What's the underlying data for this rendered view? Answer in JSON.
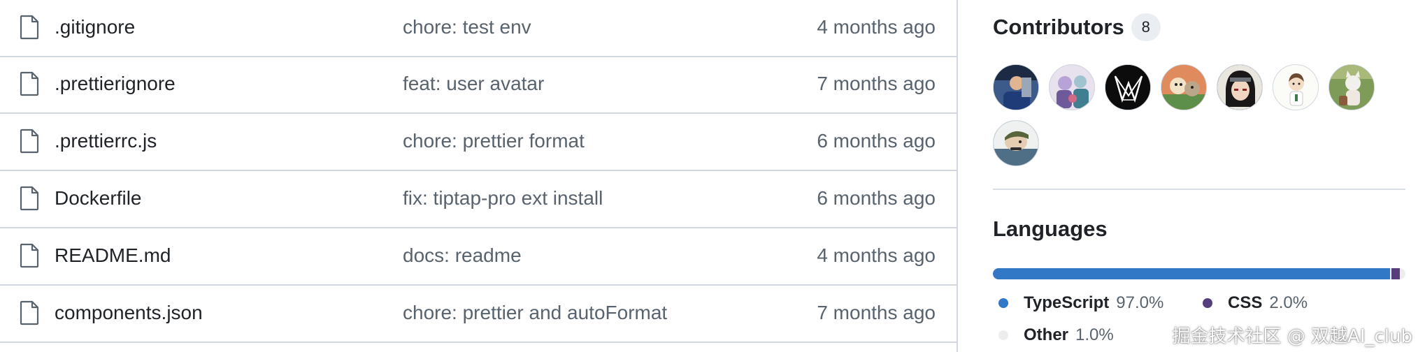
{
  "files": [
    {
      "name": ".gitignore",
      "message": "chore: test env",
      "time": "4 months ago"
    },
    {
      "name": ".prettierignore",
      "message": "feat: user avatar",
      "time": "7 months ago"
    },
    {
      "name": ".prettierrc.js",
      "message": "chore: prettier format",
      "time": "6 months ago"
    },
    {
      "name": "Dockerfile",
      "message": "fix: tiptap-pro ext install",
      "time": "6 months ago"
    },
    {
      "name": "README.md",
      "message": "docs: readme",
      "time": "4 months ago"
    },
    {
      "name": "components.json",
      "message": "chore: prettier and autoFormat",
      "time": "7 months ago"
    }
  ],
  "sidebar": {
    "contributors": {
      "title": "Contributors",
      "count": "8",
      "avatars": [
        {
          "icon": "avatar-person-blue",
          "bg": "#2f3e5c"
        },
        {
          "icon": "avatar-anime-group",
          "bg": "#c9b8d8"
        },
        {
          "icon": "avatar-logo-black",
          "bg": "#111111"
        },
        {
          "icon": "avatar-clay-figures",
          "bg": "#d9774f"
        },
        {
          "icon": "avatar-anime-dark-hair",
          "bg": "#3b3536"
        },
        {
          "icon": "avatar-chibi-white",
          "bg": "#f5f5f2"
        },
        {
          "icon": "avatar-cat-figure",
          "bg": "#7d9a52"
        },
        {
          "icon": "avatar-cartoon-man",
          "bg": "#5d7c8f"
        }
      ]
    },
    "languages": {
      "title": "Languages",
      "items": [
        {
          "name": "TypeScript",
          "percent": "97.0%",
          "value": 97.0,
          "color": "#3178c6"
        },
        {
          "name": "CSS",
          "percent": "2.0%",
          "value": 2.0,
          "color": "#563d7c"
        },
        {
          "name": "Other",
          "percent": "1.0%",
          "value": 1.0,
          "color": "#ededed"
        }
      ]
    }
  },
  "watermark": "掘金技术社区 @ 双越AI_club"
}
